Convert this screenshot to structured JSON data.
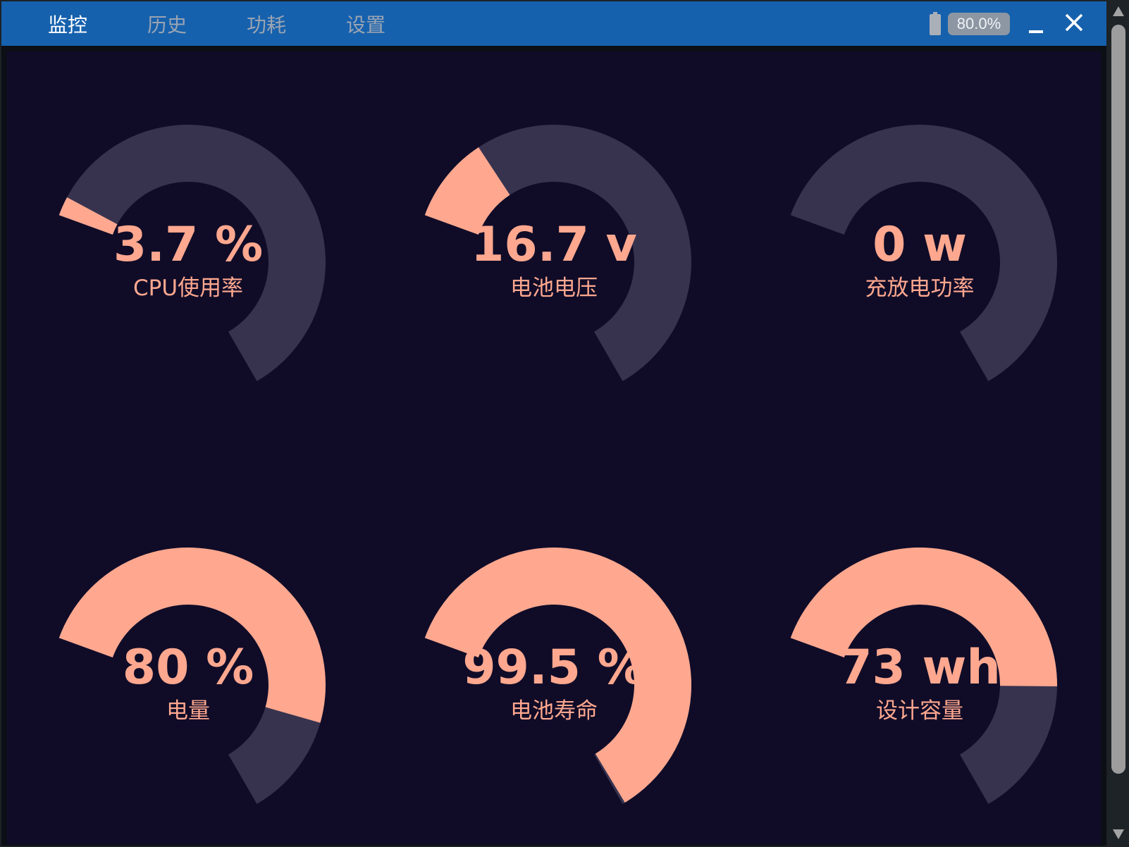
{
  "titlebar": {
    "tabs": [
      {
        "label": "监控",
        "active": true
      },
      {
        "label": "历史",
        "active": false
      },
      {
        "label": "功耗",
        "active": false
      },
      {
        "label": "设置",
        "active": false
      }
    ],
    "battery_icon": "battery-icon",
    "battery_percent": "80.0%",
    "minimize_icon": "minimize-icon",
    "close_icon": "close-icon"
  },
  "gauges": [
    {
      "value_text": "3.7 %",
      "label": "CPU使用率",
      "fraction": 0.037
    },
    {
      "value_text": "16.7 v",
      "label": "电池电压",
      "fraction": 0.167
    },
    {
      "value_text": "0 w",
      "label": "充放电功率",
      "fraction": 0.0
    },
    {
      "value_text": "80 %",
      "label": "电量",
      "fraction": 0.8
    },
    {
      "value_text": "99.5 %",
      "label": "电池寿命",
      "fraction": 0.995
    },
    {
      "value_text": "73 wh",
      "label": "设计容量",
      "fraction": 0.73
    }
  ],
  "colors": {
    "titlebar": "#1661ad",
    "panel_background": "#100c28",
    "gauge_fill": "#ffa88f",
    "gauge_track": "#37334f",
    "gauge_text": "#ffa88f",
    "tab_active": "#ffffff",
    "tab_inactive": "#9aa4b3"
  },
  "scrollbar": {
    "up_icon": "scroll-up-arrow-icon",
    "down_icon": "scroll-down-arrow-icon"
  }
}
